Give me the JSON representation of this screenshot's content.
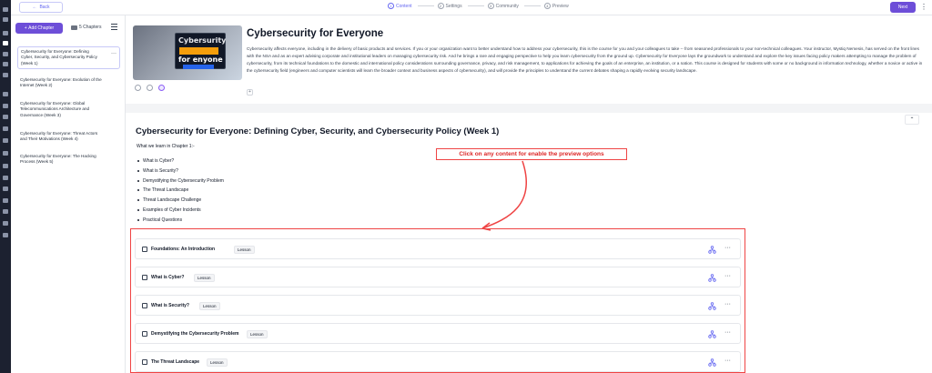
{
  "topbar": {
    "back_label": "Back",
    "steps": [
      {
        "num": "1",
        "label": "Content"
      },
      {
        "num": "2",
        "label": "Settings"
      },
      {
        "num": "3",
        "label": "Community"
      },
      {
        "num": "4",
        "label": "Preview"
      }
    ],
    "active_step": 0,
    "next_label": "Next"
  },
  "sidebar": {
    "add_chapter_label": "Add Chapter",
    "chapter_count": "5 Chapters",
    "chapters": [
      {
        "label": "Cybersecurity for Everyone: Defining Cyber, Security, and Cybersecurity Policy (Week 1)",
        "active": true
      },
      {
        "label": "Cybersecurity for Everyone: Evolution of the Internet (Week 2)"
      },
      {
        "label": "Cybersecurity for Everyone: Global Telecommunications Architecture and Governance (Week 3)"
      },
      {
        "label": "Cybersecurity for Everyone: Threat Actors and Their Motivations (Week 4)"
      },
      {
        "label": "Cybersecurity for Everyone: The Hacking Process (Week 5)"
      }
    ]
  },
  "course": {
    "cover_line1": "Cybersurity",
    "cover_line2": "",
    "cover_line3": "for enyone",
    "title": "Cybersecurity for Everyone",
    "description": "Cybersecurity affects everyone, including in the delivery of basic products and services. If you or your organization want to better understand how to address your cybersecurity, this is the course for you and your colleagues to take -- from seasoned professionals to your non-technical colleagues. Your instructor, Mystiq Nemesis, has served on the front lines with the NSA and as an expert advising corporate and institutional leaders on managing cybersecurity risk. And he brings a rare and engaging perspective to help you learn cybersecurity from the ground up. Cybersecurity for Everyone lays the groundwork to understand and explore the key issues facing policy makers attempting to manage the problem of cybersecurity, from its technical foundations to the domestic and international policy considerations surrounding governance, privacy, and risk management, to applications for achieving the goals of an enterprise, an institution, or a nation. This course is designed for students with some or no background in information technology, whether a novice or active in the cybersecurity field (engineers and computer scientists will learn the broader context and business aspects of cybersecurity), and will provide the principles to understand the current debates shaping a rapidly evolving security landscape."
  },
  "week": {
    "title": "Cybersecurity for Everyone:  Defining Cyber, Security, and Cybersecurity Policy (Week 1)",
    "learn_intro": "What we learn in Chapter 1:-",
    "topics": [
      "What is Cyber?",
      "What is Security?",
      "Demystifying the Cybersecurity Problem",
      "The Threat Landscape",
      "Threat Landscape Challenge",
      "Examples of Cyber Incidents",
      "Practical Questions"
    ]
  },
  "callout": "Click on any content for enable the preview options",
  "lessons": [
    {
      "name": "Foundations: An Introduction",
      "badge": "Lesson"
    },
    {
      "name": "What is Cyber?",
      "badge": "Lesson"
    },
    {
      "name": "What is Security?",
      "badge": "Lesson"
    },
    {
      "name": "Demystifying the Cybersecurity Problem",
      "badge": "Lesson"
    },
    {
      "name": "The Threat Landscape",
      "badge": "Lesson"
    }
  ],
  "colors": {
    "accent": "#6d4ed8",
    "callout": "#ef4444",
    "rail": "#1c2130"
  },
  "icons": [
    "back-arrow-icon",
    "kebab-icon",
    "plus-icon",
    "book-icon",
    "collapse-icon",
    "chevron-up-icon",
    "lesson-icon",
    "tree-icon",
    "more-icon"
  ]
}
